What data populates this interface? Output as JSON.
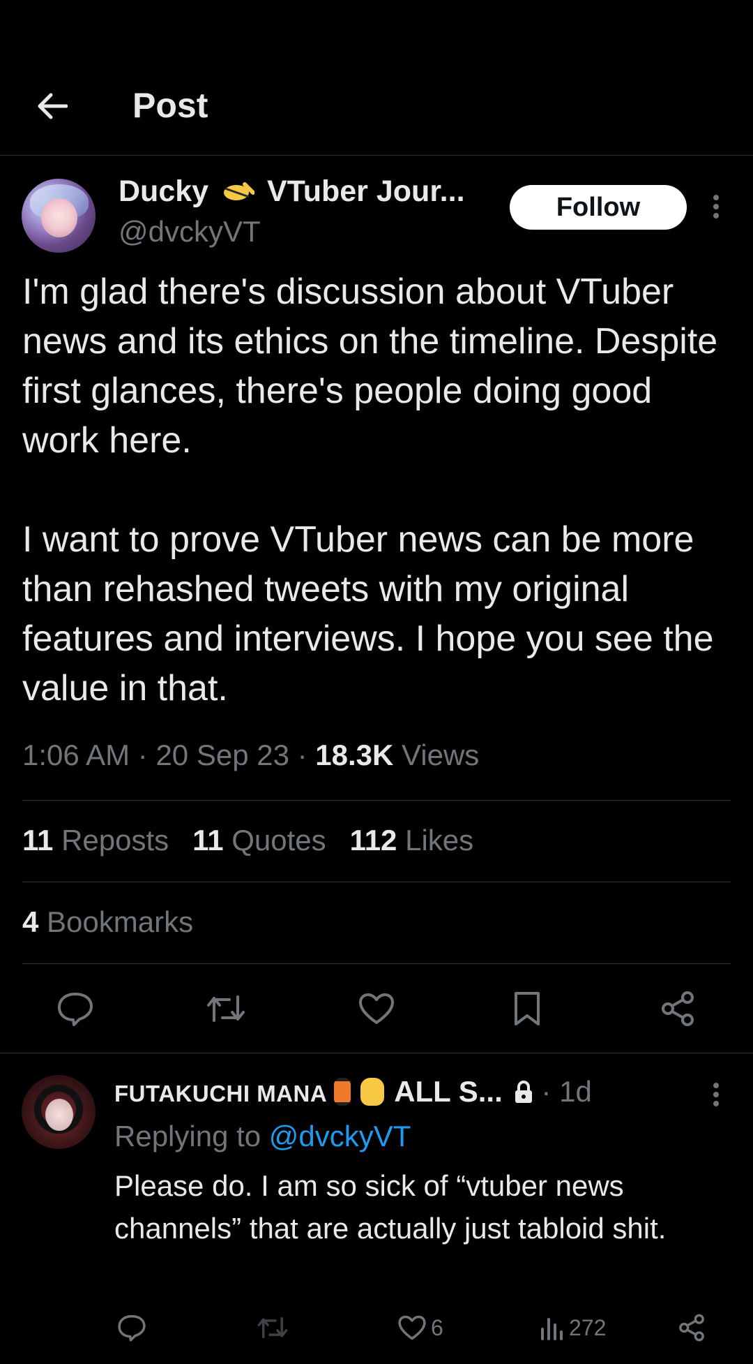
{
  "header": {
    "title": "Post"
  },
  "post": {
    "author_name": "Ducky",
    "author_name_suffix": "VTuber Jour...",
    "handle": "@dvckyVT",
    "follow_label": "Follow",
    "text": "I'm glad there's discussion about VTuber news and its ethics on the timeline. Despite first glances, there's people doing good work here.\n\nI want to prove VTuber news can be more than rehashed tweets with my original features and interviews. I hope you see the value in that.",
    "time": "1:06 AM",
    "date": "20 Sep 23",
    "views_count": "18.3K",
    "views_label": "Views",
    "reposts_count": "11",
    "reposts_label": "Reposts",
    "quotes_count": "11",
    "quotes_label": "Quotes",
    "likes_count": "112",
    "likes_label": "Likes",
    "bookmarks_count": "4",
    "bookmarks_label": "Bookmarks"
  },
  "reply": {
    "author_name": "FUTAKUCHI MANA",
    "author_name_suffix": "ALL S...",
    "age": "1d",
    "replying_prefix": "Replying to",
    "replying_handle": "@dvckyVT",
    "text": "Please do. I am so sick of “vtuber news channels” that are actually just tabloid shit.",
    "like_count": "6",
    "views_count": "272"
  },
  "colors": {
    "background": "#000000",
    "text": "#e7e9ea",
    "muted": "#71767b",
    "link": "#1d9bf0",
    "divider": "#2f3336"
  },
  "icons": [
    "back-arrow-icon",
    "more-icon",
    "reply-icon",
    "repost-icon",
    "like-icon",
    "bookmark-icon",
    "share-icon",
    "views-icon",
    "lock-icon",
    "salute-emoji-icon",
    "lantern-emoji-icon",
    "rock-hand-emoji-icon"
  ]
}
